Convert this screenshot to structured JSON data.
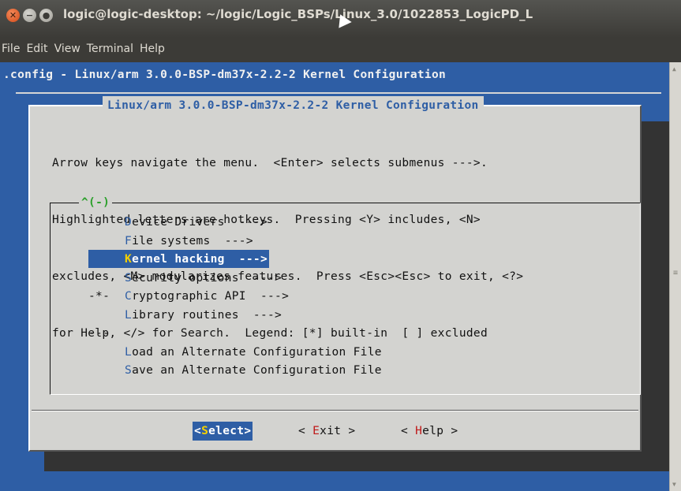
{
  "window": {
    "title": "logic@logic-desktop: ~/logic/Logic_BSPs/Linux_3.0/1022853_LogicPD_L",
    "close_glyph": "✕",
    "minimize_glyph": "−",
    "maximize_glyph": "●"
  },
  "menubar": {
    "items": [
      "File",
      "Edit",
      "View",
      "Terminal",
      "Help"
    ]
  },
  "terminal": {
    "config_title": ".config - Linux/arm 3.0.0-BSP-dm37x-2.2-2 Kernel Configuration",
    "dialog_title": "Linux/arm 3.0.0-BSP-dm37x-2.2-2 Kernel Configuration",
    "help_lines": [
      "Arrow keys navigate the menu.  <Enter> selects submenus --->.",
      "Highlighted letters are hotkeys.  Pressing <Y> includes, <N>",
      "excludes, <M> modularizes features.  Press <Esc><Esc> to exit, <?>",
      "for Help, </> for Search.  Legend: [*] built-in  [ ] excluded"
    ],
    "scroll_indicator": "^(-)",
    "menu_items": [
      {
        "prefix": "",
        "hot": "D",
        "rest": "evice Drivers  --->",
        "selected": false
      },
      {
        "prefix": "",
        "hot": "F",
        "rest": "ile systems  --->",
        "selected": false
      },
      {
        "prefix": "",
        "hot": "K",
        "rest": "ernel hacking  --->",
        "selected": true
      },
      {
        "prefix": "",
        "hot": "S",
        "rest": "ecurity options  --->",
        "selected": false
      },
      {
        "prefix": "-*-",
        "hot": "C",
        "rest": "ryptographic API  --->",
        "selected": false
      },
      {
        "prefix": "",
        "hot": "L",
        "rest": "ibrary routines  --->",
        "selected": false
      },
      {
        "prefix": "---",
        "hot": "",
        "rest": "",
        "selected": false
      },
      {
        "prefix": "",
        "hot": "L",
        "rest": "oad an Alternate Configuration File",
        "selected": false
      },
      {
        "prefix": "",
        "hot": "S",
        "rest": "ave an Alternate Configuration File",
        "selected": false
      }
    ],
    "buttons": [
      {
        "pre": "<",
        "hot": "S",
        "post": "elect>",
        "active": true
      },
      {
        "pre": "< ",
        "hot": "E",
        "post": "xit >",
        "active": false
      },
      {
        "pre": "< ",
        "hot": "H",
        "post": "elp >",
        "active": false
      }
    ]
  },
  "colors": {
    "terminal_bg": "#2e5ea5",
    "dialog_bg": "#d3d3d0",
    "hotkey_selected": "#f5d000",
    "button_hotkey": "#c01818",
    "scroll_indicator": "#2ca02c"
  }
}
